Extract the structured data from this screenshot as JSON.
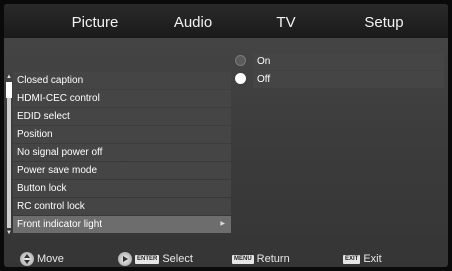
{
  "tabs": [
    {
      "label": "Picture"
    },
    {
      "label": "Audio"
    },
    {
      "label": "TV"
    },
    {
      "label": "Setup",
      "active": true
    }
  ],
  "menu": {
    "items": [
      {
        "label": "Closed caption"
      },
      {
        "label": "HDMI-CEC control"
      },
      {
        "label": "EDID select"
      },
      {
        "label": "Position"
      },
      {
        "label": "No signal power off"
      },
      {
        "label": "Power save mode"
      },
      {
        "label": "Button lock"
      },
      {
        "label": "RC control lock"
      },
      {
        "label": "Front indicator light",
        "selected": true,
        "has_submenu": true
      }
    ]
  },
  "options": [
    {
      "label": "On",
      "selected": false
    },
    {
      "label": "Off",
      "selected": true
    }
  ],
  "footer": {
    "move_label": "Move",
    "select_key": "ENTER",
    "select_label": "Select",
    "return_key": "MENU",
    "return_label": "Return",
    "exit_key": "EXIT",
    "exit_label": "Exit"
  },
  "colors": {
    "menu_item_bg": "#454545",
    "menu_item_selected_bg": "#6d6d6d",
    "tab_bar_bg": "#1e1e1e"
  },
  "icons": {
    "move": "dpad-up-down-icon",
    "select": "play-circle-icon",
    "submenu": "arrow-right-icon"
  }
}
